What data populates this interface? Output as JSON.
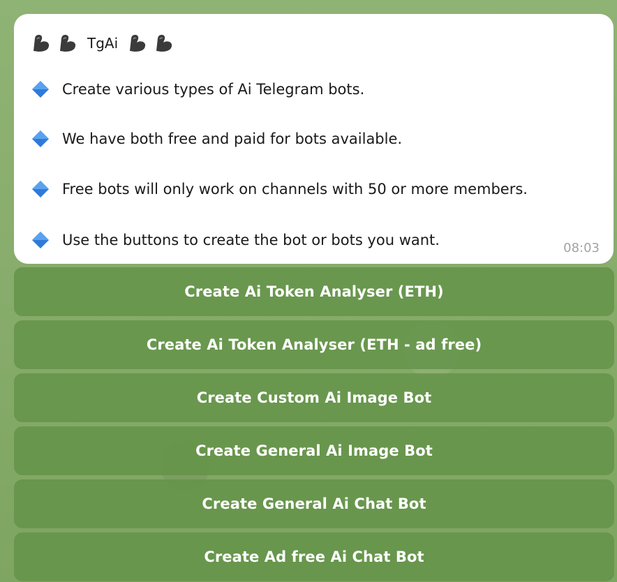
{
  "header": {
    "title": "TgAi",
    "left_emoji": [
      "flexed-biceps",
      "flexed-biceps"
    ],
    "right_emoji": [
      "flexed-biceps",
      "flexed-biceps"
    ]
  },
  "message": {
    "lines": [
      "Create various types of Ai Telegram bots.",
      "We have both free and paid for bots available.",
      "Free bots will only work on channels with 50 or more members.",
      "Use the buttons to create the bot or bots you want."
    ],
    "bullet_icon": "blue-diamond",
    "timestamp": "08:03"
  },
  "buttons": [
    "Create Ai Token Analyser (ETH)",
    "Create Ai Token Analyser (ETH - ad free)",
    "Create Custom Ai Image Bot",
    "Create General Ai Image Bot",
    "Create General Ai Chat Bot",
    "Create Ad free Ai Chat Bot"
  ],
  "colors": {
    "chat_background": "#86a86a",
    "bubble": "#ffffff",
    "button": "#639248",
    "diamond": "#2f7ad9",
    "timestamp": "#a3a3a3"
  }
}
